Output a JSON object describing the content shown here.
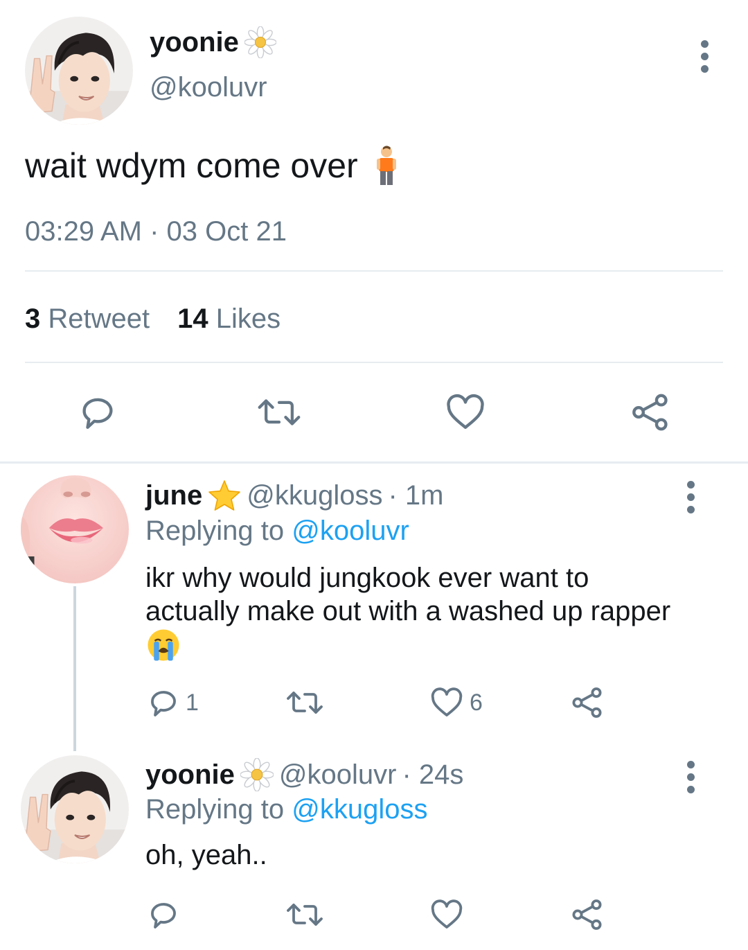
{
  "colors": {
    "accent": "#1da1f2",
    "muted": "#657786",
    "text": "#14171a",
    "divider": "#e6ecf0"
  },
  "main_tweet": {
    "display_name": "yoonie",
    "badge_icon": "daisy-icon",
    "handle": "@kooluvr",
    "text": "wait wdym come over",
    "emoji_icon": "person-standing-emoji",
    "timestamp": "03:29 AM · 03 Oct 21",
    "retweet_count": "3",
    "retweet_label": "Retweet",
    "like_count": "14",
    "like_label": "Likes"
  },
  "replies": [
    {
      "display_name": "june",
      "badge_icon": "star-icon",
      "handle": "@kkugloss",
      "time": "· 1m",
      "replying_prefix": "Replying to",
      "replying_to": "@kooluvr",
      "text_line1": "ikr why would jungkook ever want to",
      "text_line2": "actually make out with a washed up rapper",
      "emoji_icon": "loudly-crying-face-emoji",
      "reply_count": "1",
      "like_count": "6"
    },
    {
      "display_name": "yoonie",
      "badge_icon": "daisy-icon",
      "handle": "@kooluvr",
      "time": "· 24s",
      "replying_prefix": "Replying to",
      "replying_to": "@kkugloss",
      "text": "oh, yeah.."
    }
  ]
}
